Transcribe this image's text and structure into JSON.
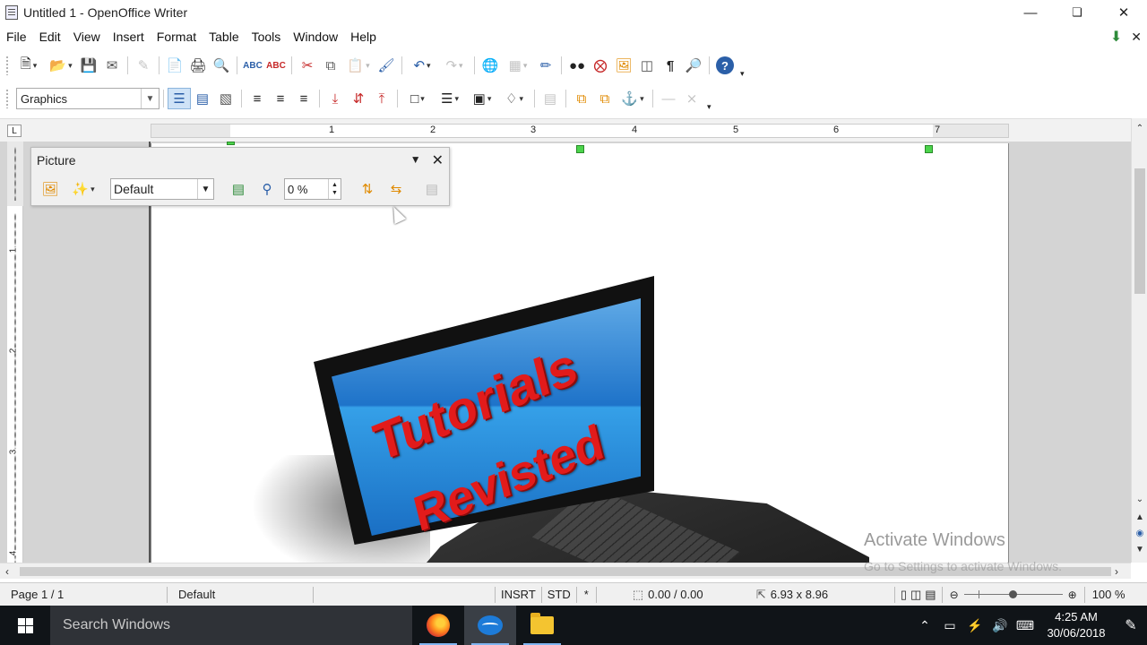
{
  "window": {
    "title": "Untitled 1 - OpenOffice Writer",
    "minimize_icon": "minimize-icon",
    "maximize_icon": "restore-icon",
    "close_icon": "close-icon"
  },
  "menu": {
    "items": [
      "File",
      "Edit",
      "View",
      "Insert",
      "Format",
      "Table",
      "Tools",
      "Window",
      "Help"
    ]
  },
  "toolbar2": {
    "paragraph_style": "Graphics"
  },
  "ruler": {
    "labels": [
      "1",
      "2",
      "3",
      "4",
      "5",
      "6",
      "7"
    ],
    "vlabels": [
      "1",
      "2",
      "3",
      "4"
    ],
    "tab_marker": "L"
  },
  "picture_toolbar": {
    "title": "Picture",
    "graphics_mode": "Default",
    "transparency": "0 %"
  },
  "document": {
    "image_text_line1": "Tutorials",
    "image_text_line2": "Revisted"
  },
  "watermark": {
    "line1": "Activate Windows",
    "line2": "Go to Settings to activate Windows."
  },
  "status": {
    "page": "Page 1 / 1",
    "page_style": "Default",
    "insert_mode": "INSRT",
    "selection_mode": "STD",
    "modified": "*",
    "position": "0.00 / 0.00",
    "size": "6.93 x 8.96",
    "zoom": "100 %",
    "zoom_level": 0.5
  },
  "taskbar": {
    "search_placeholder": "Search Windows",
    "time": "4:25 AM",
    "date": "30/06/2018"
  },
  "colors": {
    "selection_handle": "#4cd44c",
    "taskbar_bg": "#101418",
    "image_text": "#e21b1b"
  }
}
